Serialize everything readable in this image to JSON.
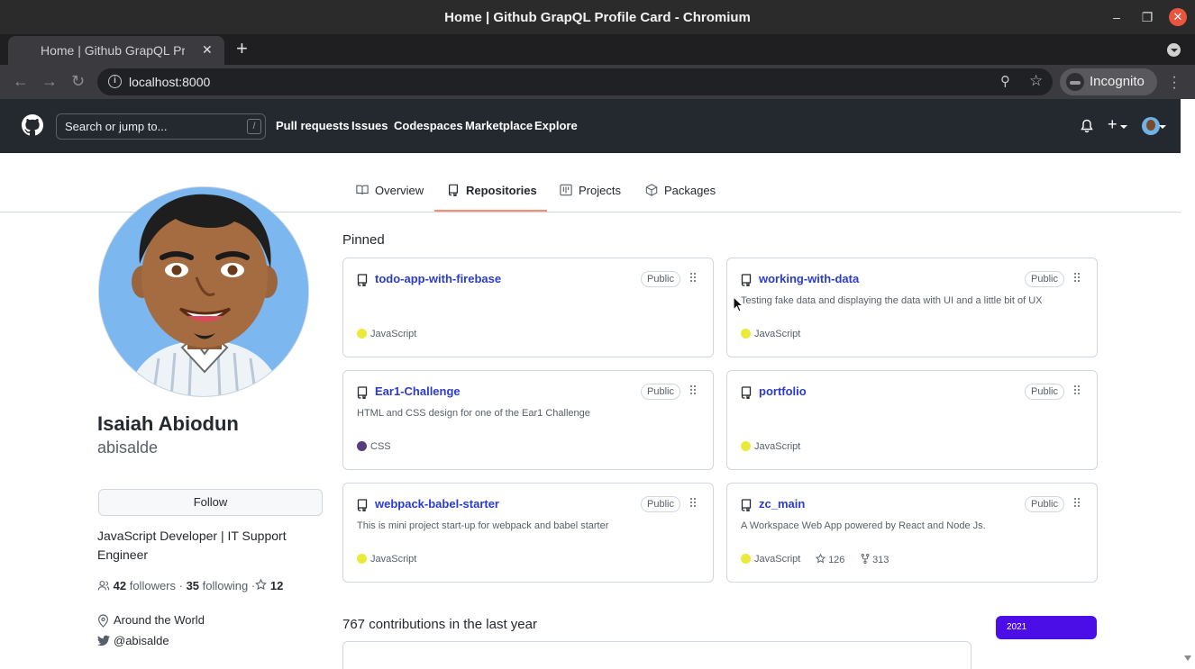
{
  "window": {
    "title": "Home | Github GrapQL Profile Card - Chromium"
  },
  "browser": {
    "tab_title": "Home | Github GrapQL Profile Card",
    "url": "localhost:8000",
    "incognito_label": "Incognito"
  },
  "gh_header": {
    "search_placeholder": "Search or jump to...",
    "search_shortcut": "/",
    "nav": [
      "Pull requests",
      "Issues",
      "Codespaces",
      "Marketplace",
      "Explore"
    ]
  },
  "profile_tabs": [
    "Overview",
    "Repositories",
    "Projects",
    "Packages"
  ],
  "profile": {
    "name": "Isaiah Abiodun",
    "login": "abisalde",
    "follow_label": "Follow",
    "bio": "JavaScript Developer | IT Support Engineer",
    "followers": "42",
    "followers_label": "followers",
    "following": "35",
    "following_label": "following",
    "stars": "12",
    "location": "Around the World",
    "twitter": "@abisalde"
  },
  "pinned": {
    "title": "Pinned",
    "repos": [
      {
        "name": "todo-app-with-firebase",
        "visibility": "Public",
        "description": "",
        "language": "JavaScript",
        "lang_color": "#e9ea3a"
      },
      {
        "name": "working-with-data",
        "visibility": "Public",
        "description": "Testing fake data and displaying the data with UI and a little bit of UX",
        "language": "JavaScript",
        "lang_color": "#e9ea3a"
      },
      {
        "name": "Ear1-Challenge",
        "visibility": "Public",
        "description": "HTML and CSS design for one of the Ear1 Challenge",
        "language": "CSS",
        "lang_color": "#563d7c"
      },
      {
        "name": "portfolio",
        "visibility": "Public",
        "description": "",
        "language": "JavaScript",
        "lang_color": "#e9ea3a"
      },
      {
        "name": "webpack-babel-starter",
        "visibility": "Public",
        "description": "This is mini project start-up for webpack and babel starter",
        "language": "JavaScript",
        "lang_color": "#e9ea3a"
      },
      {
        "name": "zc_main",
        "visibility": "Public",
        "description": "A Workspace Web App powered by React and Node Js.",
        "language": "JavaScript",
        "lang_color": "#e9ea3a",
        "stars": "126",
        "forks": "313"
      }
    ]
  },
  "contributions": {
    "title": "767 contributions in the last year",
    "year": "2021"
  }
}
